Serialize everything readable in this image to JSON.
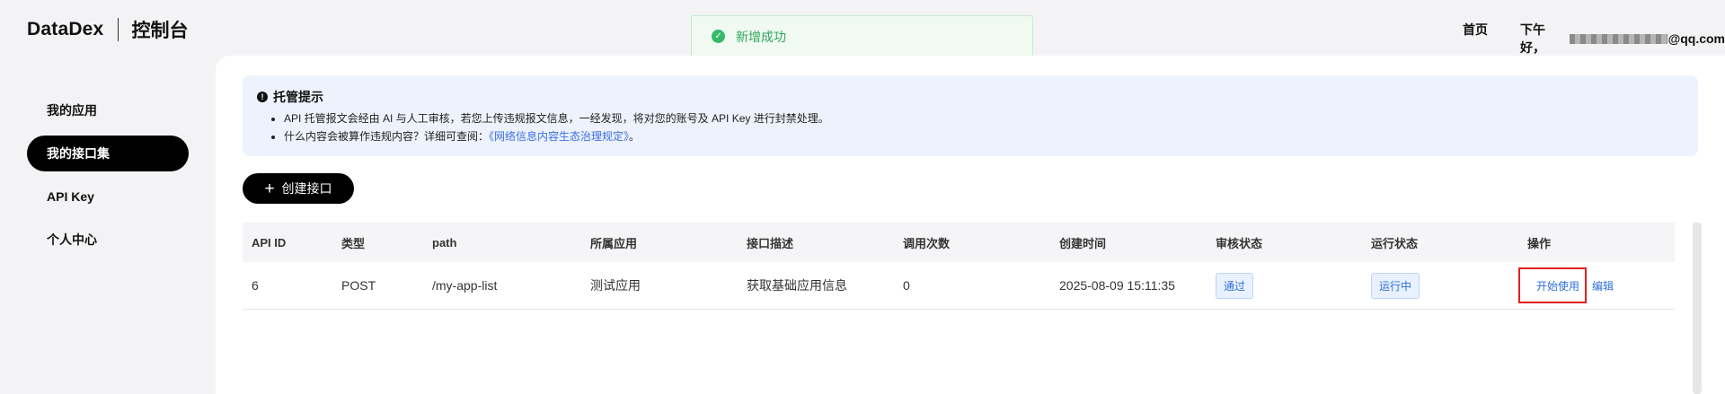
{
  "header": {
    "brand": "DataDex",
    "brand_sub": "控制台",
    "home": "首页",
    "greeting": "下午好，",
    "email_suffix": "@qq.com"
  },
  "toast": {
    "text": "新增成功"
  },
  "sidebar": {
    "items": [
      {
        "label": "我的应用"
      },
      {
        "label": "我的接口集",
        "active": true
      },
      {
        "label": "API Key"
      },
      {
        "label": "个人中心"
      }
    ]
  },
  "notice": {
    "title": "托管提示",
    "line1": "API 托管报文会经由 AI 与人工审核，若您上传违规报文信息，一经发现，将对您的账号及 API Key 进行封禁处理。",
    "line2_prefix": "什么内容会被算作违规内容？详细可查阅：",
    "line2_link": "《网络信息内容生态治理规定》",
    "line2_suffix": "。"
  },
  "create_button": "创建接口",
  "table": {
    "columns": [
      "API ID",
      "类型",
      "path",
      "所属应用",
      "接口描述",
      "调用次数",
      "创建时间",
      "审核状态",
      "运行状态",
      "操作"
    ],
    "rows": [
      {
        "id": "6",
        "type": "POST",
        "path": "/my-app-list",
        "app": "测试应用",
        "desc": "获取基础应用信息",
        "calls": "0",
        "created": "2025-08-09 15:11:35",
        "review": "通过",
        "run": "运行中",
        "op_start": "开始使用",
        "op_edit": "编辑"
      }
    ]
  },
  "colors": {
    "primary": "#000000",
    "link": "#2f6fd9",
    "success": "#37b96a",
    "highlight": "#e02020",
    "notice_bg": "#eef2fc"
  }
}
